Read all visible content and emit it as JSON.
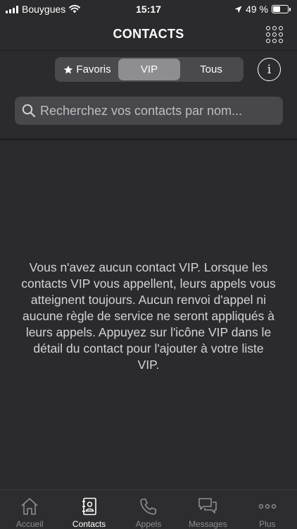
{
  "status_bar": {
    "carrier": "Bouygues",
    "time": "15:17",
    "battery": "49 %",
    "battery_level": 0.49
  },
  "header": {
    "title": "CONTACTS"
  },
  "segmented": {
    "favorites": "Favoris",
    "vip": "VIP",
    "all": "Tous",
    "selected": "VIP"
  },
  "info": {
    "label": "i"
  },
  "search": {
    "placeholder": "Recherchez vos contacts par nom..."
  },
  "empty_state": {
    "message": "Vous n'avez aucun contact VIP. Lorsque les contacts VIP vous appellent, leurs appels vous atteignent toujours. Aucun renvoi d'appel ni aucune règle de service ne seront appliqués à leurs appels. Appuyez sur l'icône VIP dans le détail du contact pour l'ajouter à votre liste VIP."
  },
  "tab_bar": {
    "items": [
      {
        "label": "Accueil",
        "icon": "home-icon",
        "active": false
      },
      {
        "label": "Contacts",
        "icon": "contacts-book-icon",
        "active": true
      },
      {
        "label": "Appels",
        "icon": "phone-icon",
        "active": false
      },
      {
        "label": "Messages",
        "icon": "messages-icon",
        "active": false
      },
      {
        "label": "Plus",
        "icon": "more-icon",
        "active": false
      }
    ]
  },
  "colors": {
    "background": "#2b2b2d",
    "segment_active": "#8d8d92",
    "tab_inactive": "#8e8e93"
  }
}
